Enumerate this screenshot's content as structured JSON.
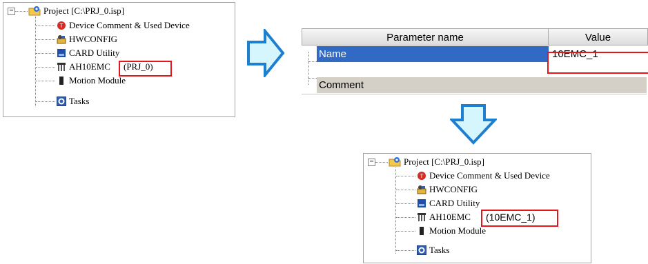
{
  "tree_before": {
    "root_label": "Project [C:\\PRJ_0.isp]",
    "expander_symbol": "−",
    "items": [
      {
        "label": "Device Comment & Used Device",
        "icon": "device-comment-icon"
      },
      {
        "label": "HWCONFIG",
        "icon": "hwconfig-icon"
      },
      {
        "label": "CARD Utility",
        "icon": "card-utility-icon"
      },
      {
        "label": "AH10EMC",
        "suffix": "(PRJ_0)",
        "icon": "module-icon"
      },
      {
        "label": "Motion Module",
        "icon": "motion-module-icon"
      },
      {
        "label": "Tasks",
        "icon": "tasks-icon"
      }
    ]
  },
  "param_table": {
    "header_name": "Parameter name",
    "header_value": "Value",
    "rows": [
      {
        "name": "Name",
        "value": "10EMC_1"
      },
      {
        "name": "Comment",
        "value": ""
      }
    ]
  },
  "tree_after": {
    "root_label": "Project [C:\\PRJ_0.isp]",
    "expander_symbol": "−",
    "items": [
      {
        "label": "Device Comment & Used Device",
        "icon": "device-comment-icon"
      },
      {
        "label": "HWCONFIG",
        "icon": "hwconfig-icon"
      },
      {
        "label": "CARD Utility",
        "icon": "card-utility-icon"
      },
      {
        "label": "AH10EMC",
        "suffix": "(10EMC_1)",
        "icon": "module-icon"
      },
      {
        "label": "Motion Module",
        "icon": "motion-module-icon"
      },
      {
        "label": "Tasks",
        "icon": "tasks-icon"
      }
    ]
  },
  "colors": {
    "highlight_border": "#e8141b",
    "selection": "#316ac5",
    "arrow_fill": "#d6f6fd",
    "arrow_stroke": "#1e7fd0"
  }
}
